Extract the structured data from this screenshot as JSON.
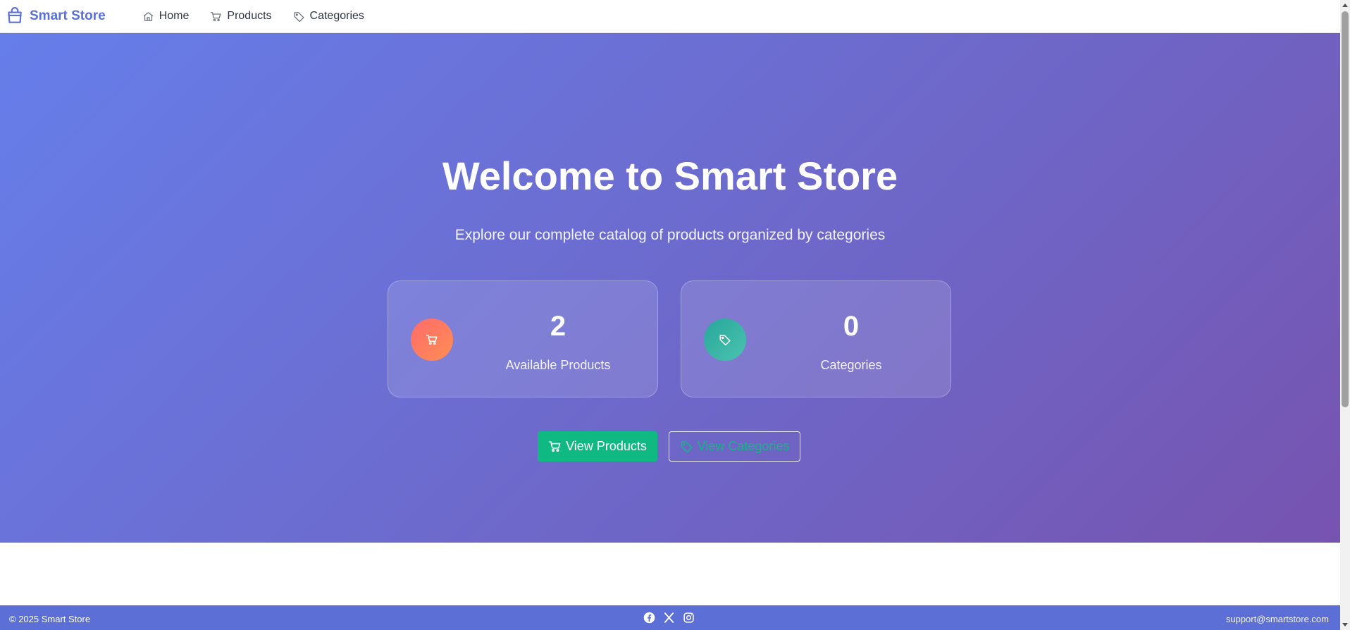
{
  "brand": {
    "name": "Smart Store",
    "icon": "shopping-bag-icon",
    "color": "#5a6fd8"
  },
  "nav": {
    "items": [
      {
        "label": "Home",
        "icon": "home-icon"
      },
      {
        "label": "Products",
        "icon": "cart-icon"
      },
      {
        "label": "Categories",
        "icon": "tag-icon"
      }
    ]
  },
  "hero": {
    "title": "Welcome to Smart Store",
    "subtitle": "Explore our complete catalog of products organized by categories",
    "stats": [
      {
        "value": "2",
        "label": "Available Products",
        "icon": "cart-icon",
        "color": "#ff6b6b"
      },
      {
        "value": "0",
        "label": "Categories",
        "icon": "tag-icon",
        "color": "#26a69a"
      }
    ],
    "buttons": {
      "primary": {
        "label": "View Products",
        "icon": "cart-icon",
        "color": "#10b981"
      },
      "secondary": {
        "label": "View Categories",
        "icon": "tag-icon"
      }
    },
    "gradient": [
      "#667eea",
      "#7753b0"
    ]
  },
  "footer": {
    "copyright": "© 2025 Smart Store",
    "social": [
      "facebook-icon",
      "x-icon",
      "instagram-icon"
    ],
    "email": "support@smartstore.com",
    "color": "#5b6fd6"
  }
}
